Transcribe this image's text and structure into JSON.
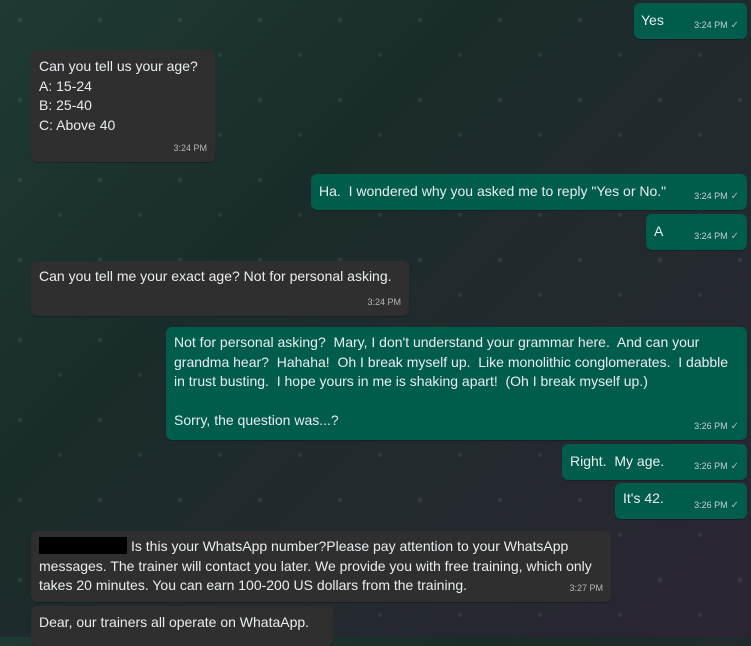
{
  "messages": [
    {
      "direction": "out",
      "text": "Yes",
      "time": "3:24 PM",
      "status": "✓"
    },
    {
      "direction": "in",
      "text": "Can you tell us your age?\nA: 15-24\nB: 25-40\nC: Above 40",
      "time": "3:24 PM"
    },
    {
      "direction": "out",
      "text": "Ha.  I wondered why you asked me to reply \"Yes or No.\"",
      "time": "3:24 PM",
      "status": "✓"
    },
    {
      "direction": "out",
      "text": "A",
      "time": "3:24 PM",
      "status": "✓"
    },
    {
      "direction": "in",
      "text": "Can you tell me your exact age? Not for personal asking.",
      "time": "3:24 PM"
    },
    {
      "direction": "out",
      "text": "Not for personal asking?  Mary, I don't understand your grammar here.  And can your grandma hear?  Hahaha!  Oh I break myself up.  Like monolithic conglomerates.  I dabble in trust busting.  I hope yours in me is shaking apart!  (Oh I break myself up.)\n\nSorry, the question was...?",
      "time": "3:26 PM",
      "status": "✓"
    },
    {
      "direction": "out",
      "text": "Right.  My age.",
      "time": "3:26 PM",
      "status": "✓"
    },
    {
      "direction": "out",
      "text": "It's 42.",
      "time": "3:26 PM",
      "status": "✓"
    },
    {
      "direction": "in",
      "text": "Is this your WhatsApp number?Please pay attention to your WhatsApp messages. The trainer will contact you later. We provide you with free training, which only takes 20 minutes. You can earn 100-200 US dollars from the training.",
      "time": "3:27 PM"
    },
    {
      "direction": "in",
      "text": "Dear, our trainers all operate on WhataApp."
    }
  ]
}
